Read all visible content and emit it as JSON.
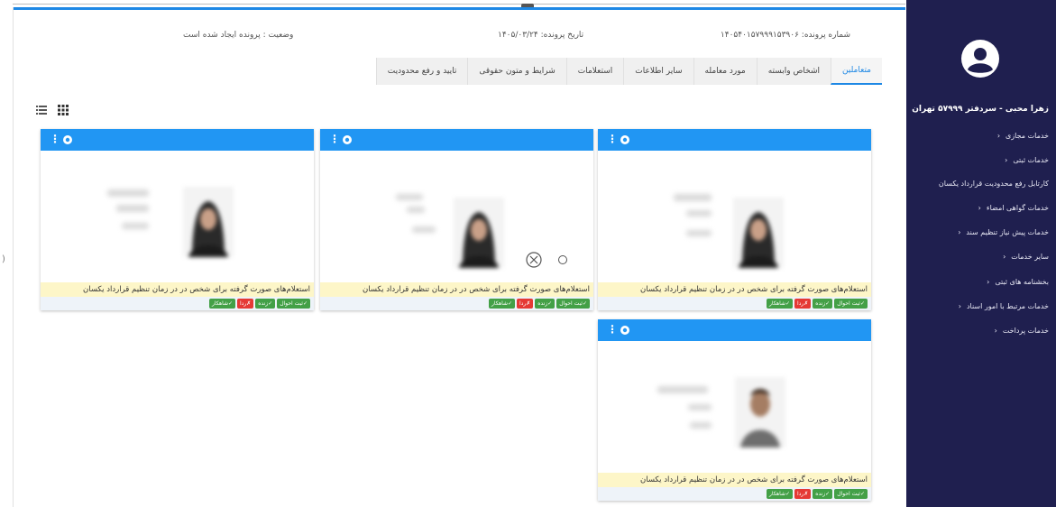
{
  "sidebar": {
    "user_name": "زهرا محبی - سردفتر ۵۷۹۹۹ تهران",
    "items": [
      {
        "label": "خدمات مجازی",
        "chevron": true
      },
      {
        "label": "خدمات ثبتی",
        "chevron": true
      },
      {
        "label": "کارتابل رفع محدودیت قرارداد یکسان",
        "chevron": false
      },
      {
        "label": "خدمات گواهی امضاء",
        "chevron": true
      },
      {
        "label": "خدمات پیش نیاز تنظیم سند",
        "chevron": true
      },
      {
        "label": "سایر خدمات",
        "chevron": true
      },
      {
        "label": "بخشنامه های ثبتی",
        "chevron": true
      },
      {
        "label": "خدمات مرتبط با امور اسناد",
        "chevron": true
      },
      {
        "label": "خدمات پرداخت",
        "chevron": true
      }
    ],
    "chevron_glyph": "‹"
  },
  "info": {
    "file_number": "شماره پرونده: ۱۴۰۵۴۰۱۵۷۹۹۹۱۵۳۹۰۶",
    "file_date": "تاریخ پرونده: ۱۴۰۵/۰۳/۲۴",
    "status": "وضعیت : پرونده ایجاد شده است"
  },
  "tabs": [
    {
      "label": "متعاملین",
      "active": true
    },
    {
      "label": "اشخاص وابسته",
      "active": false
    },
    {
      "label": "مورد معامله",
      "active": false
    },
    {
      "label": "سایر اطلاعات",
      "active": false
    },
    {
      "label": "استعلامات",
      "active": false
    },
    {
      "label": "شرایط و متون حقوقی",
      "active": false
    },
    {
      "label": "تایید و رفع محدودیت",
      "active": false
    }
  ],
  "cards": [
    {
      "caption": "استعلام‌های صورت گرفته برای شخص در در زمان تنظیم قرارداد یکسان",
      "btn_register": "✓ثبت احوال",
      "btn_alive": "✓زنده",
      "btn_reject": "✗ردا",
      "btn_shahkar": "✓شاهکار"
    },
    {
      "caption": "استعلام‌های صورت گرفته برای شخص در در زمان تنظیم قرارداد یکسان",
      "btn_register": "✓ثبت احوال",
      "btn_alive": "✓زنده",
      "btn_reject": "✗ردا",
      "btn_shahkar": "✓شاهکار"
    },
    {
      "caption": "استعلام‌های صورت گرفته برای شخص در در زمان تنظیم قرارداد یکسان",
      "btn_register": "✓ثبت احوال",
      "btn_alive": "✓زنده",
      "btn_reject": "✗ردا",
      "btn_shahkar": "✓شاهکار"
    },
    {
      "caption": "استعلام‌های صورت گرفته برای شخص در در زمان تنظیم قرارداد یکسان",
      "btn_register": "✓ثبت احوال",
      "btn_alive": "✓زنده",
      "btn_reject": "✗ردا",
      "btn_shahkar": "✓شاهکار"
    }
  ],
  "icons": {
    "list_view": "list-view-icon",
    "grid_view": "grid-view-icon",
    "kebab": "⋮"
  },
  "colors": {
    "sidebar_bg": "#1f1f4f",
    "accent": "#2196f3",
    "caption_bg": "#fdf6c8",
    "success": "#43a047",
    "danger": "#e53935"
  }
}
